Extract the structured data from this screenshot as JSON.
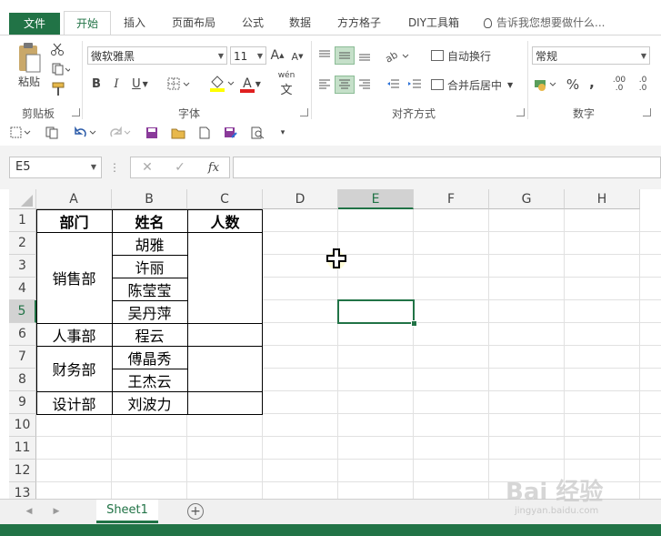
{
  "tabs": {
    "file": "文件",
    "home": "开始",
    "insert": "插入",
    "page_layout": "页面布局",
    "formulas": "公式",
    "data": "数据",
    "fangfang": "方方格子",
    "diy": "DIY工具箱",
    "tell_me": "告诉我您想要做什么..."
  },
  "ribbon": {
    "clipboard": {
      "paste": "粘贴",
      "label": "剪贴板"
    },
    "font": {
      "name": "微软雅黑",
      "size": "11",
      "bold": "B",
      "italic": "I",
      "underline": "U",
      "grow": "A",
      "shrink": "A",
      "font_color": "A",
      "phonetic": "wén",
      "label": "字体"
    },
    "alignment": {
      "wrap_text": "自动换行",
      "merge_center": "合并后居中",
      "label": "对齐方式"
    },
    "number": {
      "format": "常规",
      "percent": "%",
      "comma": ",",
      "inc_decimal": ".00",
      "dec_decimal": ".0",
      "label": "数字"
    }
  },
  "formula_bar": {
    "name_box": "E5",
    "formula": "",
    "fx": "fx"
  },
  "columns": [
    "A",
    "B",
    "C",
    "D",
    "E",
    "F",
    "G",
    "H"
  ],
  "rows": [
    "1",
    "2",
    "3",
    "4",
    "5",
    "6",
    "7",
    "8",
    "9",
    "10",
    "11",
    "12",
    "13"
  ],
  "table": {
    "headers": {
      "dept": "部门",
      "name": "姓名",
      "count": "人数"
    },
    "departments": [
      "销售部",
      "人事部",
      "财务部",
      "设计部"
    ],
    "names": [
      "胡雅",
      "许丽",
      "陈莹莹",
      "吴丹萍",
      "程云",
      "傅晶秀",
      "王杰云",
      "刘波力"
    ]
  },
  "sheets": [
    "Sheet1"
  ],
  "watermark": {
    "main": "Bai 经验",
    "sub": "jingyan.baidu.com"
  },
  "colors": {
    "accent": "#217346",
    "selected_header": "#d2d2d2",
    "highlight": "#c5e0c9"
  }
}
